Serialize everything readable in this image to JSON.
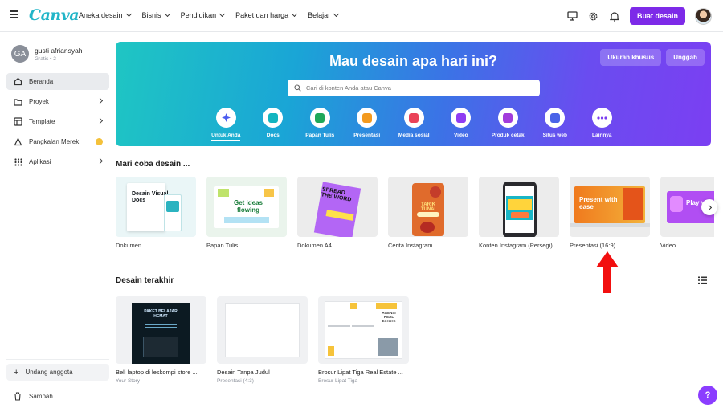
{
  "topbar": {
    "logo": "Canva",
    "nav": [
      "Aneka desain",
      "Bisnis",
      "Pendidikan",
      "Paket dan harga",
      "Belajar"
    ],
    "create_button": "Buat desain"
  },
  "sidebar": {
    "avatar_initials": "GA",
    "user_name": "gusti afriansyah",
    "user_sub": "Gratis • 2",
    "items": [
      {
        "label": "Beranda"
      },
      {
        "label": "Proyek"
      },
      {
        "label": "Template"
      },
      {
        "label": "Pangkalan Merek"
      },
      {
        "label": "Aplikasi"
      }
    ],
    "invite": "Undang anggota",
    "trash": "Sampah"
  },
  "hero": {
    "title": "Mau desain apa hari ini?",
    "custom_size": "Ukuran khusus",
    "upload": "Unggah",
    "search_placeholder": "Cari di konten Anda atau Canva",
    "categories": [
      {
        "label": "Untuk Anda",
        "color": "#4b5cf0"
      },
      {
        "label": "Docs",
        "color": "#13b5c0"
      },
      {
        "label": "Papan Tulis",
        "color": "#1fa85a"
      },
      {
        "label": "Presentasi",
        "color": "#f39a1e"
      },
      {
        "label": "Media sosial",
        "color": "#ea4258"
      },
      {
        "label": "Video",
        "color": "#8f3cf2"
      },
      {
        "label": "Produk cetak",
        "color": "#a23cdc"
      },
      {
        "label": "Situs web",
        "color": "#4a63e8"
      },
      {
        "label": "Lainnya",
        "color": "#7a3cf0"
      }
    ]
  },
  "try_design": {
    "title": "Mari coba desain ...",
    "tiles": [
      {
        "label": "Dokumen",
        "text": "Desain Visual Docs"
      },
      {
        "label": "Papan Tulis",
        "text": "Get ideas flowing"
      },
      {
        "label": "Dokumen A4",
        "text": "SPREAD THE WORD"
      },
      {
        "label": "Cerita Instagram",
        "text": "TARIK TUNAI"
      },
      {
        "label": "Konten Instagram (Persegi)",
        "text": ""
      },
      {
        "label": "Presentasi (16:9)",
        "text": "Present with ease"
      },
      {
        "label": "Video",
        "text": "Play vid"
      }
    ]
  },
  "recent": {
    "title": "Desain terakhir",
    "items": [
      {
        "title": "Beli laptop di leskompi store ...",
        "sub": "Your Story",
        "thumb_text": "PAKET BELAJAR HEMAT"
      },
      {
        "title": "Desain Tanpa Judul",
        "sub": "Presentasi (4:3)",
        "thumb_text": ""
      },
      {
        "title": "Brosur Lipat Tiga Real Estate ...",
        "sub": "Brosur Lipat Tiga",
        "thumb_text": "AGENSI REAL ESTATE"
      }
    ]
  },
  "help": "?"
}
